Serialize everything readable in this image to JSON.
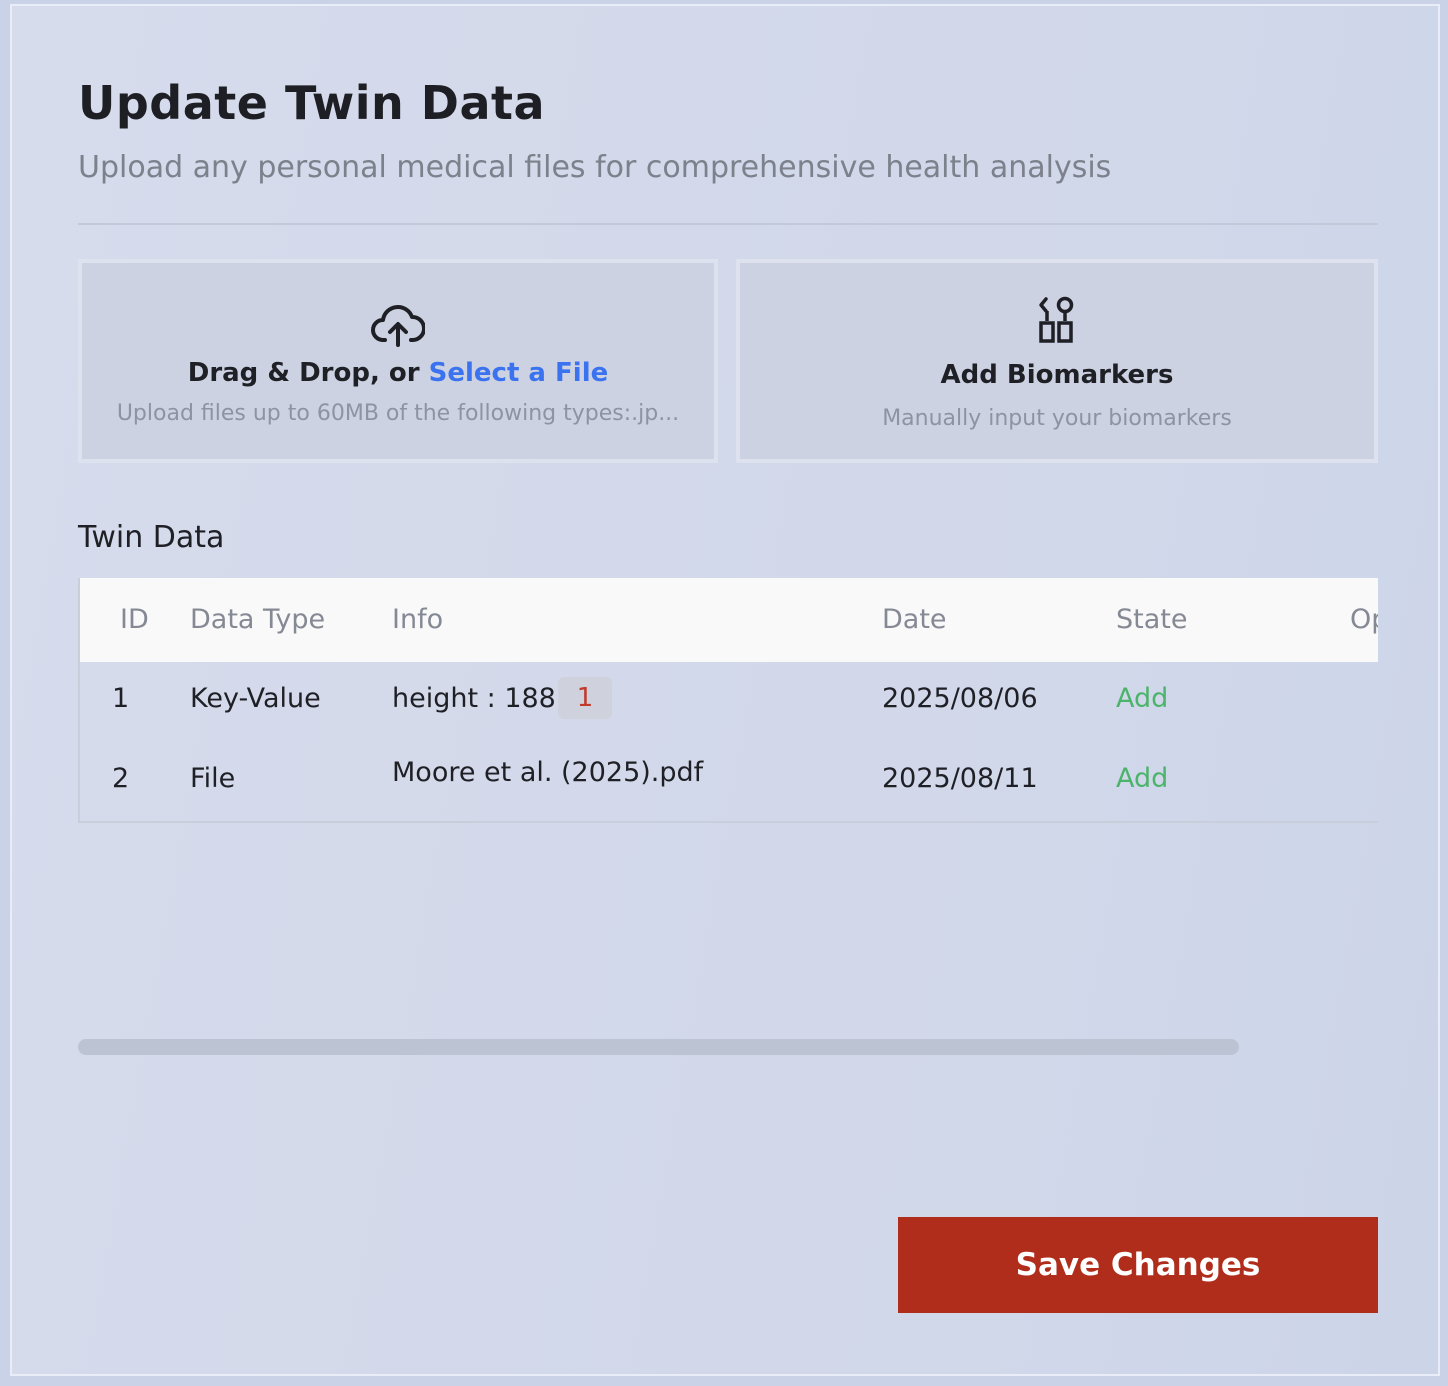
{
  "header": {
    "title": "Update Twin Data",
    "subtitle": "Upload any personal medical files for comprehensive health analysis"
  },
  "upload_card": {
    "icon": "cloud-upload-icon",
    "lead_text": "Drag & Drop, or ",
    "link_text": "Select a File",
    "hint": "Upload files up to 60MB of the following types:.jp..."
  },
  "biomarker_card": {
    "icon": "biomarker-icon",
    "title": "Add Biomarkers",
    "hint": "Manually input your biomarkers"
  },
  "table": {
    "section_title": "Twin Data",
    "columns": [
      "ID",
      "Data Type",
      "Info",
      "Date",
      "State",
      "Op"
    ],
    "rows": [
      {
        "id": "1",
        "type": "Key-Value",
        "info": "height : 188",
        "badge": "1",
        "date": "2025/08/06",
        "state": "Add"
      },
      {
        "id": "2",
        "type": "File",
        "info": "Moore et al. (2025).pdf",
        "date": "2025/08/11",
        "state": "Add"
      }
    ]
  },
  "actions": {
    "save_label": "Save Changes"
  },
  "colors": {
    "primary_button": "#b02d1c",
    "link": "#3a72f0",
    "state_add": "#4cb36a",
    "badge_text": "#c0392b"
  }
}
